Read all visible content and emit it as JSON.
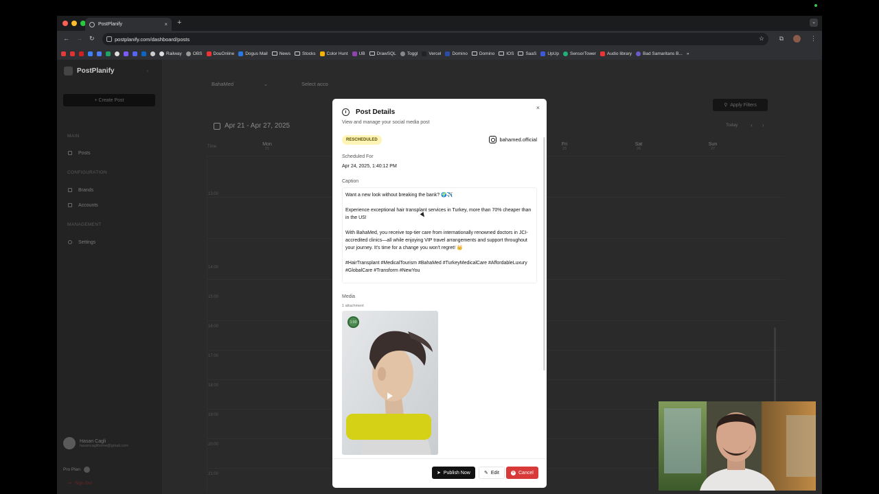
{
  "browser": {
    "tab_title": "PostPlanify",
    "url": "postplanify.com/dashboard/posts",
    "bookmarks": [
      "Railway",
      "OBS",
      "DouOnline",
      "Dogus Mail",
      "News",
      "Stocks",
      "Color Hunt",
      "UB",
      "DrawSQL",
      "Toggl",
      "Vercel",
      "Domino",
      "Domino",
      "IOS",
      "SaaS",
      "UpUp",
      "SensorTower",
      "Audio library",
      "Bad Samaritans B..."
    ],
    "bookmark_more": "»"
  },
  "sidebar": {
    "brand": "PostPlanify",
    "create_post": "+ Create Post",
    "sections": {
      "main": "MAIN",
      "configuration": "CONFIGURATION",
      "management": "MANAGEMENT"
    },
    "items": {
      "posts": "Posts",
      "brands": "Brands",
      "accounts": "Accounts",
      "settings": "Settings"
    },
    "user_name": "Hasan Cagli",
    "user_email": "hasancaglihome@gmail.com",
    "plan": "Pro Plan",
    "sign_out": "Sign Out"
  },
  "calendar": {
    "brand_filter": "BahaMed",
    "account_filter": "Select acco",
    "apply_filters": "Apply Filters",
    "range": "Apr 21 - Apr 27, 2025",
    "today": "Today",
    "time_header": "Time",
    "days": [
      {
        "name": "Mon",
        "num": "21"
      },
      {
        "name": "Fri",
        "num": "25"
      },
      {
        "name": "Sat",
        "num": "26"
      },
      {
        "name": "Sun",
        "num": "27"
      }
    ],
    "times": [
      "13:00",
      "14:00",
      "15:00",
      "16:00",
      "17:00",
      "18:00",
      "19:00",
      "20:00",
      "21:00"
    ]
  },
  "modal": {
    "title": "Post Details",
    "subtitle": "View and manage your social media post",
    "status": "RESCHEDULED",
    "account": "bahamed.official",
    "scheduled_label": "Scheduled For",
    "scheduled_value": "Apr 24, 2025, 1:40:12 PM",
    "caption_label": "Caption",
    "caption": {
      "p1": "Want a new look without breaking the bank? 🌍✈️",
      "p2": "Experience exceptional hair transplant services in Turkey, more than 70% cheaper than in the US!",
      "p3": "With BahaMed, you receive top-tier care from internationally renowned doctors in JCI-accredited clinics—all while enjoying VIP travel arrangements and support throughout your journey. It's time for a change you won't regret! 👑",
      "p4": "#HairTransplant #MedicalTourism #BahaMed #TurkeyMedicalCare #AffordableLuxury #GlobalCare #Transform #NewYou"
    },
    "media_label": "Media",
    "attachment_count": "1 attachment",
    "media_duration": "1:00",
    "publish_now": "Publish Now",
    "edit": "Edit",
    "cancel": "Cancel"
  },
  "colors": {
    "status_badge_bg": "#fdf4b5",
    "cancel_red": "#d83a3a",
    "publish_black": "#111111"
  }
}
